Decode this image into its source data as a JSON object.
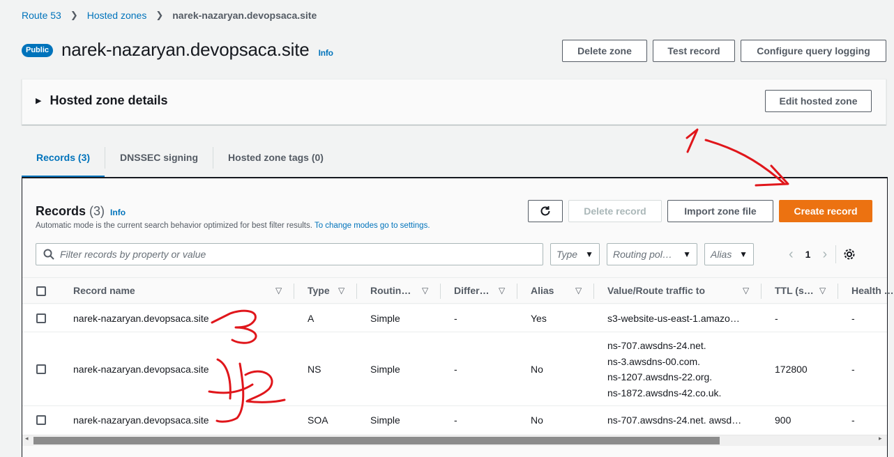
{
  "breadcrumb": {
    "items": [
      "Route 53",
      "Hosted zones"
    ],
    "current": "narek-nazaryan.devopsaca.site"
  },
  "header": {
    "badge": "Public",
    "title": "narek-nazaryan.devopsaca.site",
    "info": "Info",
    "delete_zone": "Delete zone",
    "test_record": "Test record",
    "configure_logging": "Configure query logging"
  },
  "details": {
    "title": "Hosted zone details",
    "edit": "Edit hosted zone"
  },
  "tabs": [
    {
      "label": "Records (3)",
      "active": true
    },
    {
      "label": "DNSSEC signing",
      "active": false
    },
    {
      "label": "Hosted zone tags (0)",
      "active": false
    }
  ],
  "records": {
    "title": "Records",
    "count": "(3)",
    "info": "Info",
    "desc": "Automatic mode is the current search behavior optimized for best filter results.",
    "desc_link": "To change modes go to settings.",
    "delete_record": "Delete record",
    "import_zone": "Import zone file",
    "create_record": "Create record",
    "filter_placeholder": "Filter records by property or value",
    "filters": {
      "type": "Type",
      "routing": "Routing pol…",
      "alias": "Alias"
    },
    "page": "1",
    "columns": [
      "Record name",
      "Type",
      "Routin…",
      "Differ…",
      "Alias",
      "Value/Route traffic to",
      "TTL (s…",
      "Health …"
    ],
    "rows": [
      {
        "name": "narek-nazaryan.devopsaca.site",
        "type": "A",
        "routing": "Simple",
        "differ": "-",
        "alias": "Yes",
        "value": [
          "s3-website-us-east-1.amazo…"
        ],
        "ttl": "-",
        "health": "-"
      },
      {
        "name": "narek-nazaryan.devopsaca.site",
        "type": "NS",
        "routing": "Simple",
        "differ": "-",
        "alias": "No",
        "value": [
          "ns-707.awsdns-24.net.",
          "ns-3.awsdns-00.com.",
          "ns-1207.awsdns-22.org.",
          "ns-1872.awsdns-42.co.uk."
        ],
        "ttl": "172800",
        "health": "-"
      },
      {
        "name": "narek-nazaryan.devopsaca.site",
        "type": "SOA",
        "routing": "Simple",
        "differ": "-",
        "alias": "No",
        "value": [
          "ns-707.awsdns-24.net. awsd…"
        ],
        "ttl": "900",
        "health": "-"
      }
    ]
  },
  "annotations": {
    "color": "#e0161b",
    "marks": [
      "1",
      "3",
      "42"
    ]
  },
  "colors": {
    "accent": "#0073bb",
    "primary_button": "#ec7211",
    "annotation": "#e0161b"
  }
}
